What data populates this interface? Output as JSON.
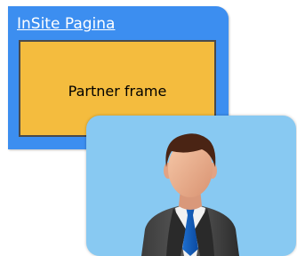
{
  "insite_page": {
    "link_label": "InSite Pagina"
  },
  "partner_frame": {
    "label": "Partner frame"
  },
  "colors": {
    "page_blue": "#3c8ef0",
    "frame_yellow": "#f4bc3e",
    "card_blue": "#88c9f2"
  },
  "icons": {
    "user": "businessman-avatar-icon"
  }
}
